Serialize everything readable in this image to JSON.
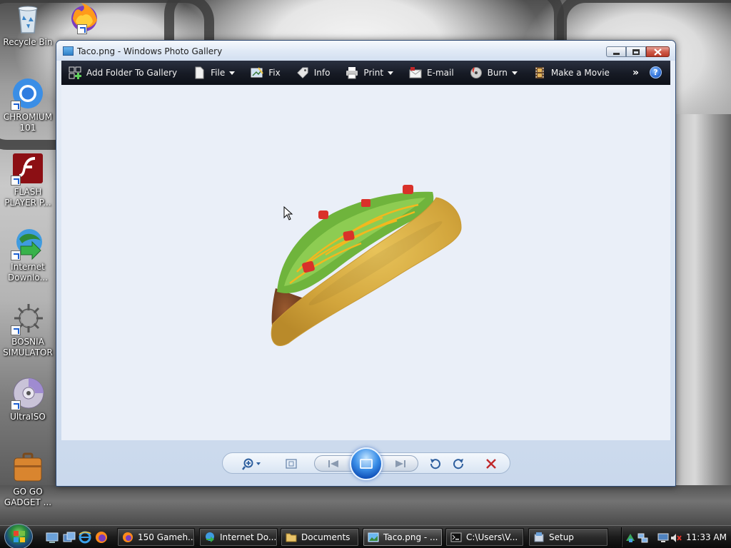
{
  "desktop": {
    "icons": [
      {
        "name": "Recycle Bin",
        "label": "Recycle Bin",
        "icon": "recycle-bin-icon"
      },
      {
        "name": "Chromium",
        "label": "CHROMIUM 101",
        "icon": "chromium-icon"
      },
      {
        "name": "Flash Player",
        "label": "FLASH PLAYER P...",
        "icon": "flash-player-icon"
      },
      {
        "name": "Internet Download Manager",
        "label": "Internet Downlo...",
        "icon": "idm-icon"
      },
      {
        "name": "Bosnia Simulator",
        "label": "BOSNIA SIMULATOR",
        "icon": "bosnia-simulator-icon"
      },
      {
        "name": "UltraISO",
        "label": "UltraISO",
        "icon": "disc-icon"
      },
      {
        "name": "Go Go Gadget",
        "label": "GO GO GADGET ...",
        "icon": "briefcase-icon"
      },
      {
        "name": "Firefox",
        "label": "",
        "icon": "firefox-icon"
      }
    ]
  },
  "window": {
    "title": "Taco.png - Windows Photo Gallery",
    "caption_buttons": [
      "minimize",
      "maximize",
      "close"
    ]
  },
  "toolbar": {
    "items": [
      {
        "label": "Add Folder To Gallery",
        "icon": "add-folder-icon",
        "dropdown": false
      },
      {
        "label": "File",
        "icon": "file-icon",
        "dropdown": true
      },
      {
        "label": "Fix",
        "icon": "fix-icon",
        "dropdown": false
      },
      {
        "label": "Info",
        "icon": "info-tag-icon",
        "dropdown": false
      },
      {
        "label": "Print",
        "icon": "printer-icon",
        "dropdown": true
      },
      {
        "label": "E-mail",
        "icon": "email-icon",
        "dropdown": false
      },
      {
        "label": "Burn",
        "icon": "burn-disc-icon",
        "dropdown": true
      },
      {
        "label": "Make a Movie",
        "icon": "film-icon",
        "dropdown": false
      }
    ],
    "overflow": "»",
    "help": "?"
  },
  "viewer": {
    "image_subject": "taco",
    "background": "#eaeff8"
  },
  "controls": {
    "buttons": [
      "zoom",
      "actual-size",
      "previous",
      "slideshow",
      "next",
      "rotate-counterclockwise",
      "rotate-clockwise",
      "delete"
    ]
  },
  "taskbar": {
    "tasks": [
      {
        "label": "150 Gameh...",
        "icon": "firefox-icon",
        "active": false
      },
      {
        "label": "Internet Do...",
        "icon": "idm-icon",
        "active": false
      },
      {
        "label": "Documents",
        "icon": "folder-icon",
        "active": false
      },
      {
        "label": "Taco.png - ...",
        "icon": "photo-gallery-icon",
        "active": true
      },
      {
        "label": "C:\\Users\\V...",
        "icon": "cmd-icon",
        "active": false
      },
      {
        "label": "Setup",
        "icon": "setup-icon",
        "active": false
      }
    ],
    "clock": "11:33 AM"
  },
  "colors": {
    "toolbar_bg": "#161a24",
    "viewer_bg": "#eaeff8",
    "delete_red": "#c0282a",
    "accent_blue": "#2f6fd6"
  }
}
